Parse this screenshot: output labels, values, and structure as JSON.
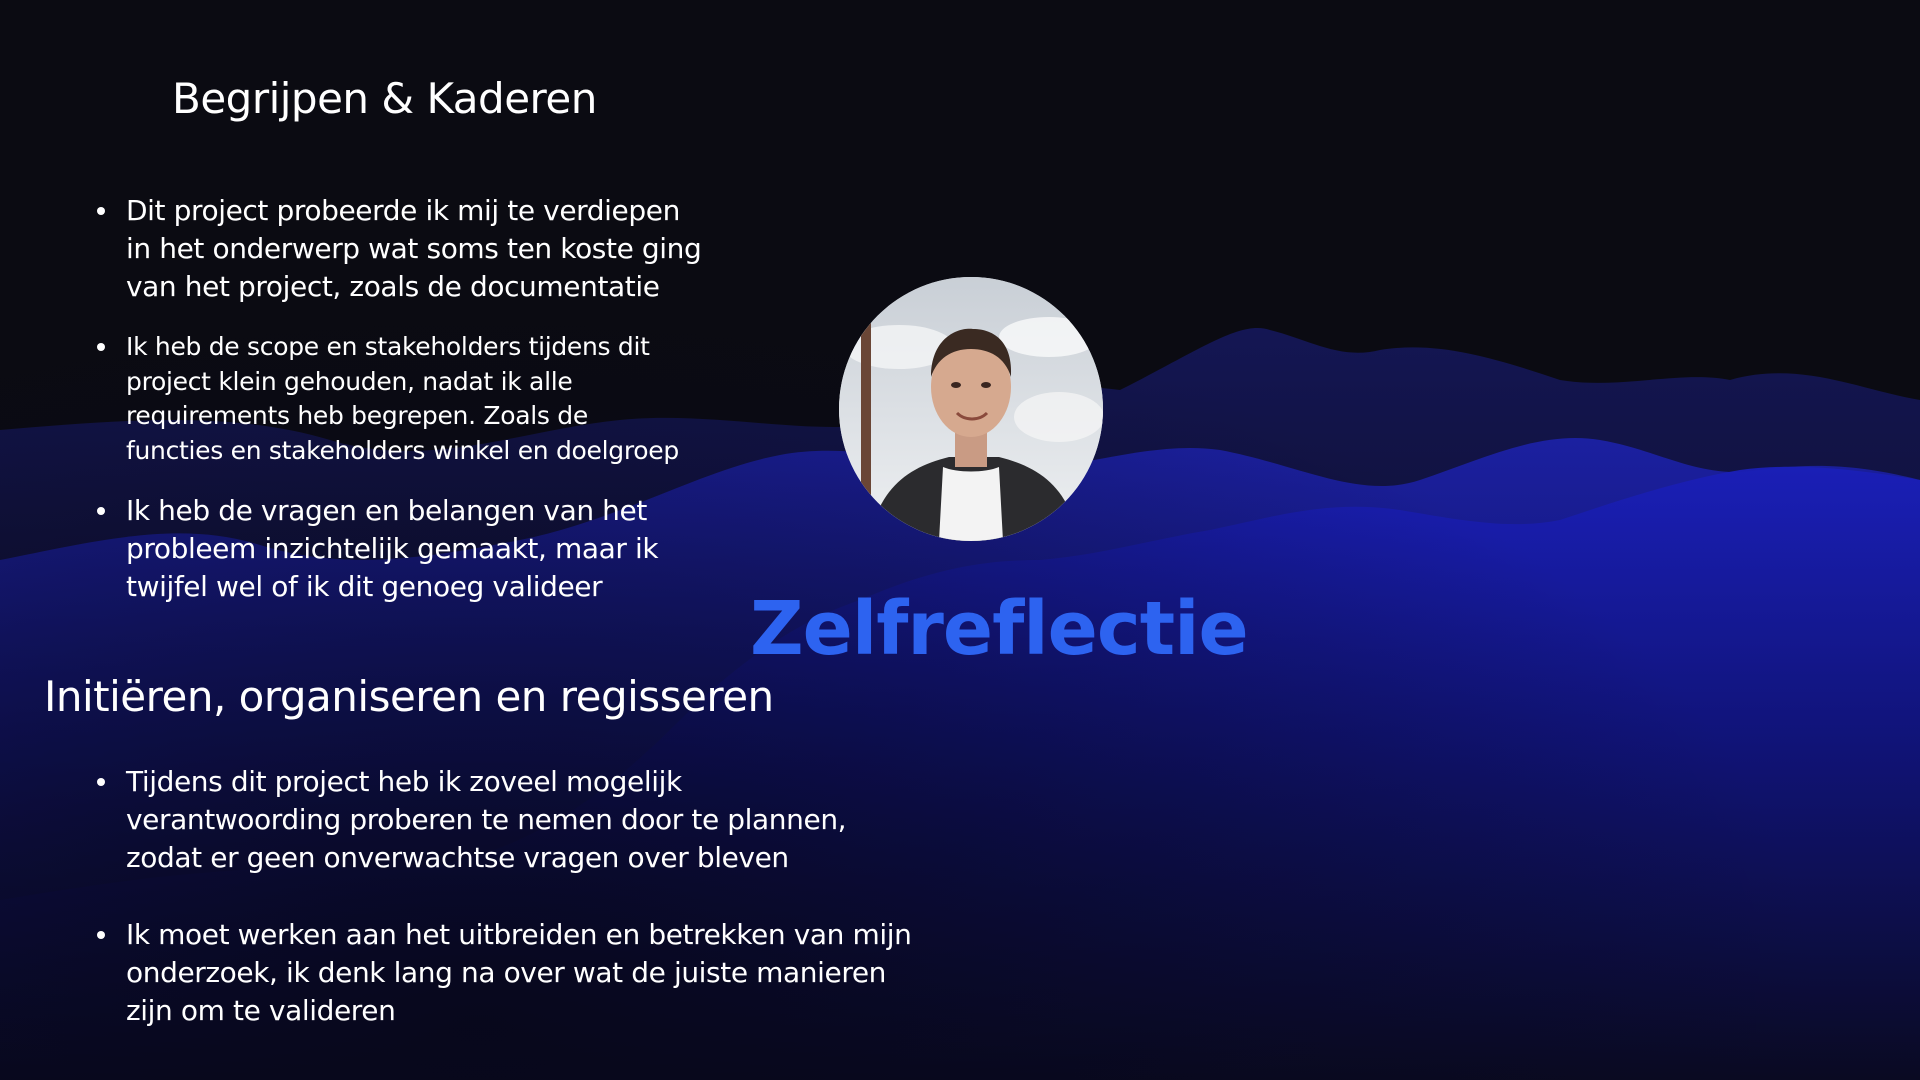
{
  "slide": {
    "heading_1": "Begrijpen & Kaderen",
    "section_1_bullets": [
      "Dit project probeerde ik mij te verdiepen\nin het onderwerp wat soms ten koste ging\nvan het project, zoals de documentatie",
      "Ik heb de scope en stakeholders tijdens dit\nproject klein gehouden, nadat ik alle\nrequirements heb begrepen. Zoals de\nfuncties en stakeholders winkel en doelgroep",
      "Ik heb de vragen en belangen van het\nprobleem inzichtelijk gemaakt, maar ik\ntwijfel wel of ik dit genoeg valideer"
    ],
    "heading_2": "Initiëren, organiseren en regisseren",
    "section_2_bullets": [
      "Tijdens dit project heb ik zoveel mogelijk\nverantwoording proberen te nemen door te plannen,\nzodat er geen onverwachtse vragen over bleven",
      "Ik moet werken aan het uitbreiden en betrekken van mijn\nonderzoek, ik denk lang na over wat de juiste manieren\nzijn om te valideren"
    ],
    "title": "Zelfreflectie",
    "portrait_icon": "portrait-photo"
  },
  "colors": {
    "background": "#0b0b12",
    "wave_blue": "#1a20a8",
    "title_blue": "#2d63f0",
    "text": "#ffffff"
  }
}
